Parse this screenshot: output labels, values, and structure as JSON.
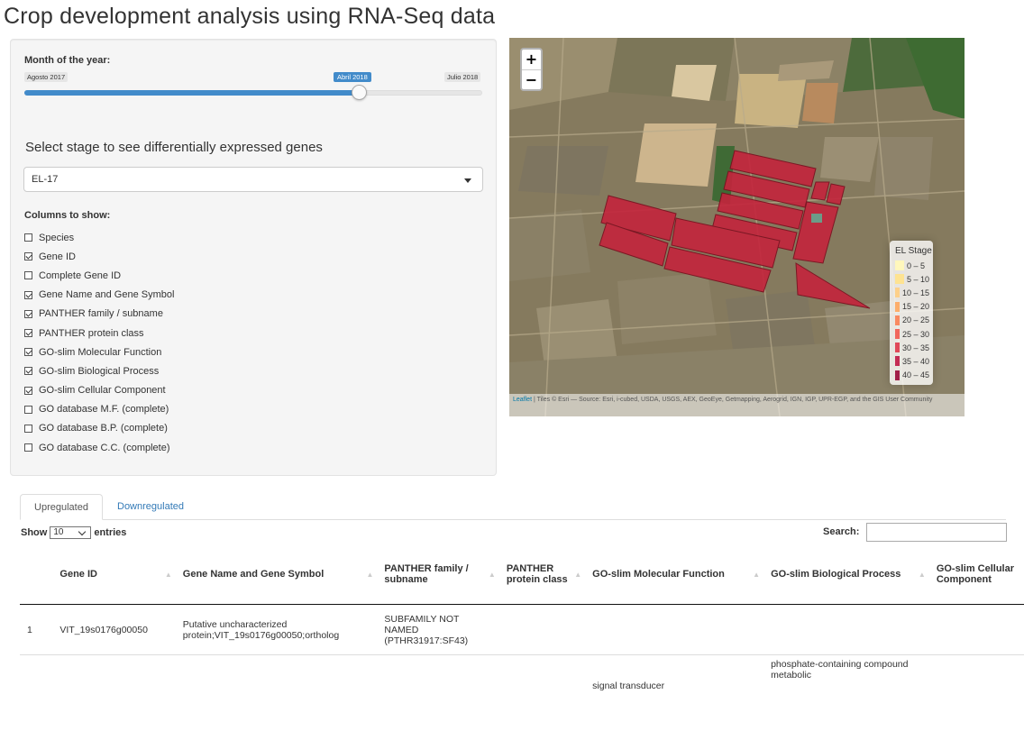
{
  "page": {
    "title": "Crop development analysis using RNA-Seq data"
  },
  "sidebar": {
    "month_label": "Month of the year:",
    "slider": {
      "min_label": "Agosto 2017",
      "max_label": "Julio 2018",
      "value_label": "Abril 2018",
      "fraction": 0.73
    },
    "stage_label": "Select stage to see differentially expressed genes",
    "stage_value": "EL-17",
    "columns_label": "Columns to show:",
    "columns": [
      {
        "label": "Species",
        "checked": false
      },
      {
        "label": "Gene ID",
        "checked": true
      },
      {
        "label": "Complete Gene ID",
        "checked": false
      },
      {
        "label": "Gene Name and Gene Symbol",
        "checked": true
      },
      {
        "label": "PANTHER family / subname",
        "checked": true
      },
      {
        "label": "PANTHER protein class",
        "checked": true
      },
      {
        "label": "GO-slim Molecular Function",
        "checked": true
      },
      {
        "label": "GO-slim Biological Process",
        "checked": true
      },
      {
        "label": "GO-slim Cellular Component",
        "checked": true
      },
      {
        "label": "GO database M.F. (complete)",
        "checked": false
      },
      {
        "label": "GO database B.P. (complete)",
        "checked": false
      },
      {
        "label": "GO database C.C. (complete)",
        "checked": false
      }
    ]
  },
  "map": {
    "zoom_in": "+",
    "zoom_out": "−",
    "legend_title": "EL Stage",
    "legend": [
      {
        "label": "0 – 5",
        "color": "#fff7bc"
      },
      {
        "label": "5 – 10",
        "color": "#fee391"
      },
      {
        "label": "10 – 15",
        "color": "#fdd08a"
      },
      {
        "label": "15 – 20",
        "color": "#fdae6b"
      },
      {
        "label": "20 – 25",
        "color": "#f98a61"
      },
      {
        "label": "25 – 30",
        "color": "#f1665c"
      },
      {
        "label": "30 – 35",
        "color": "#e04858"
      },
      {
        "label": "35 – 40",
        "color": "#c42c54"
      },
      {
        "label": "40 – 45",
        "color": "#a11f48"
      }
    ],
    "attribution_link": "Leaflet",
    "attribution_text": " | Tiles © Esri — Source: Esri, i-cubed, USDA, USGS, AEX, GeoEye, Getmapping, Aerogrid, IGN, IGP, UPR-EGP, and the GIS User Community"
  },
  "tabs": [
    {
      "label": "Upregulated"
    },
    {
      "label": "Downregulated"
    }
  ],
  "table_controls": {
    "show": "Show",
    "entries_value": "10",
    "entries": "entries",
    "search": "Search:"
  },
  "table": {
    "headers": [
      "",
      "Gene ID",
      "Gene Name and Gene Symbol",
      "PANTHER family / subname",
      "PANTHER protein class",
      "GO-slim Molecular Function",
      "GO-slim Biological Process",
      "GO-slim Cellular Component"
    ],
    "rows": [
      [
        "1",
        "VIT_19s0176g00050",
        "Putative uncharacterized protein;VIT_19s0176g00050;ortholog",
        "SUBFAMILY NOT NAMED (PTHR31917:SF43)",
        "",
        "",
        "",
        ""
      ],
      [
        "",
        "",
        "",
        "",
        "",
        "signal transducer",
        "phosphate-containing compound metabolic",
        ""
      ]
    ]
  }
}
